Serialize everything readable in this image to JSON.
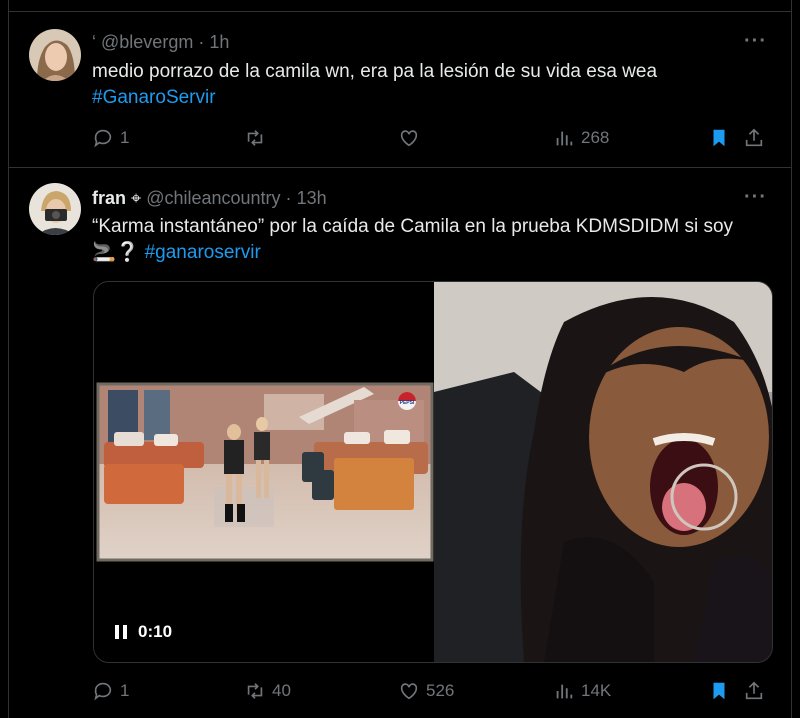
{
  "tweets": [
    {
      "handle_prefix": "‘",
      "handle": "@blevergm",
      "dot": "·",
      "time": "1h",
      "text": "medio porrazo de la camila wn, era pa la lesión de su vida esa wea",
      "hashtag": "#GanaroServir",
      "replies": "1",
      "retweets": "",
      "likes": "",
      "views": "268"
    },
    {
      "name": "fran",
      "badge": "⌖",
      "handle": "@chileancountry",
      "dot": "·",
      "time": "13h",
      "text_line1": "“Karma instantáneo” por la caída de Camila en la prueba KDMSDIDM si soy",
      "emoji": "🚬❔",
      "hashtag": "#ganaroservir",
      "video_time": "0:10",
      "video_badge": "PEPSI",
      "replies": "1",
      "retweets": "40",
      "likes": "526",
      "views": "14K"
    }
  ],
  "more_label": "···",
  "colors": {
    "accent": "#1d9bf0",
    "muted": "#71767b",
    "text": "#e7e9ea",
    "bg": "#000000"
  },
  "icons": [
    "reply-icon",
    "retweet-icon",
    "like-icon",
    "views-icon",
    "bookmark-icon",
    "share-icon",
    "pause-icon"
  ]
}
